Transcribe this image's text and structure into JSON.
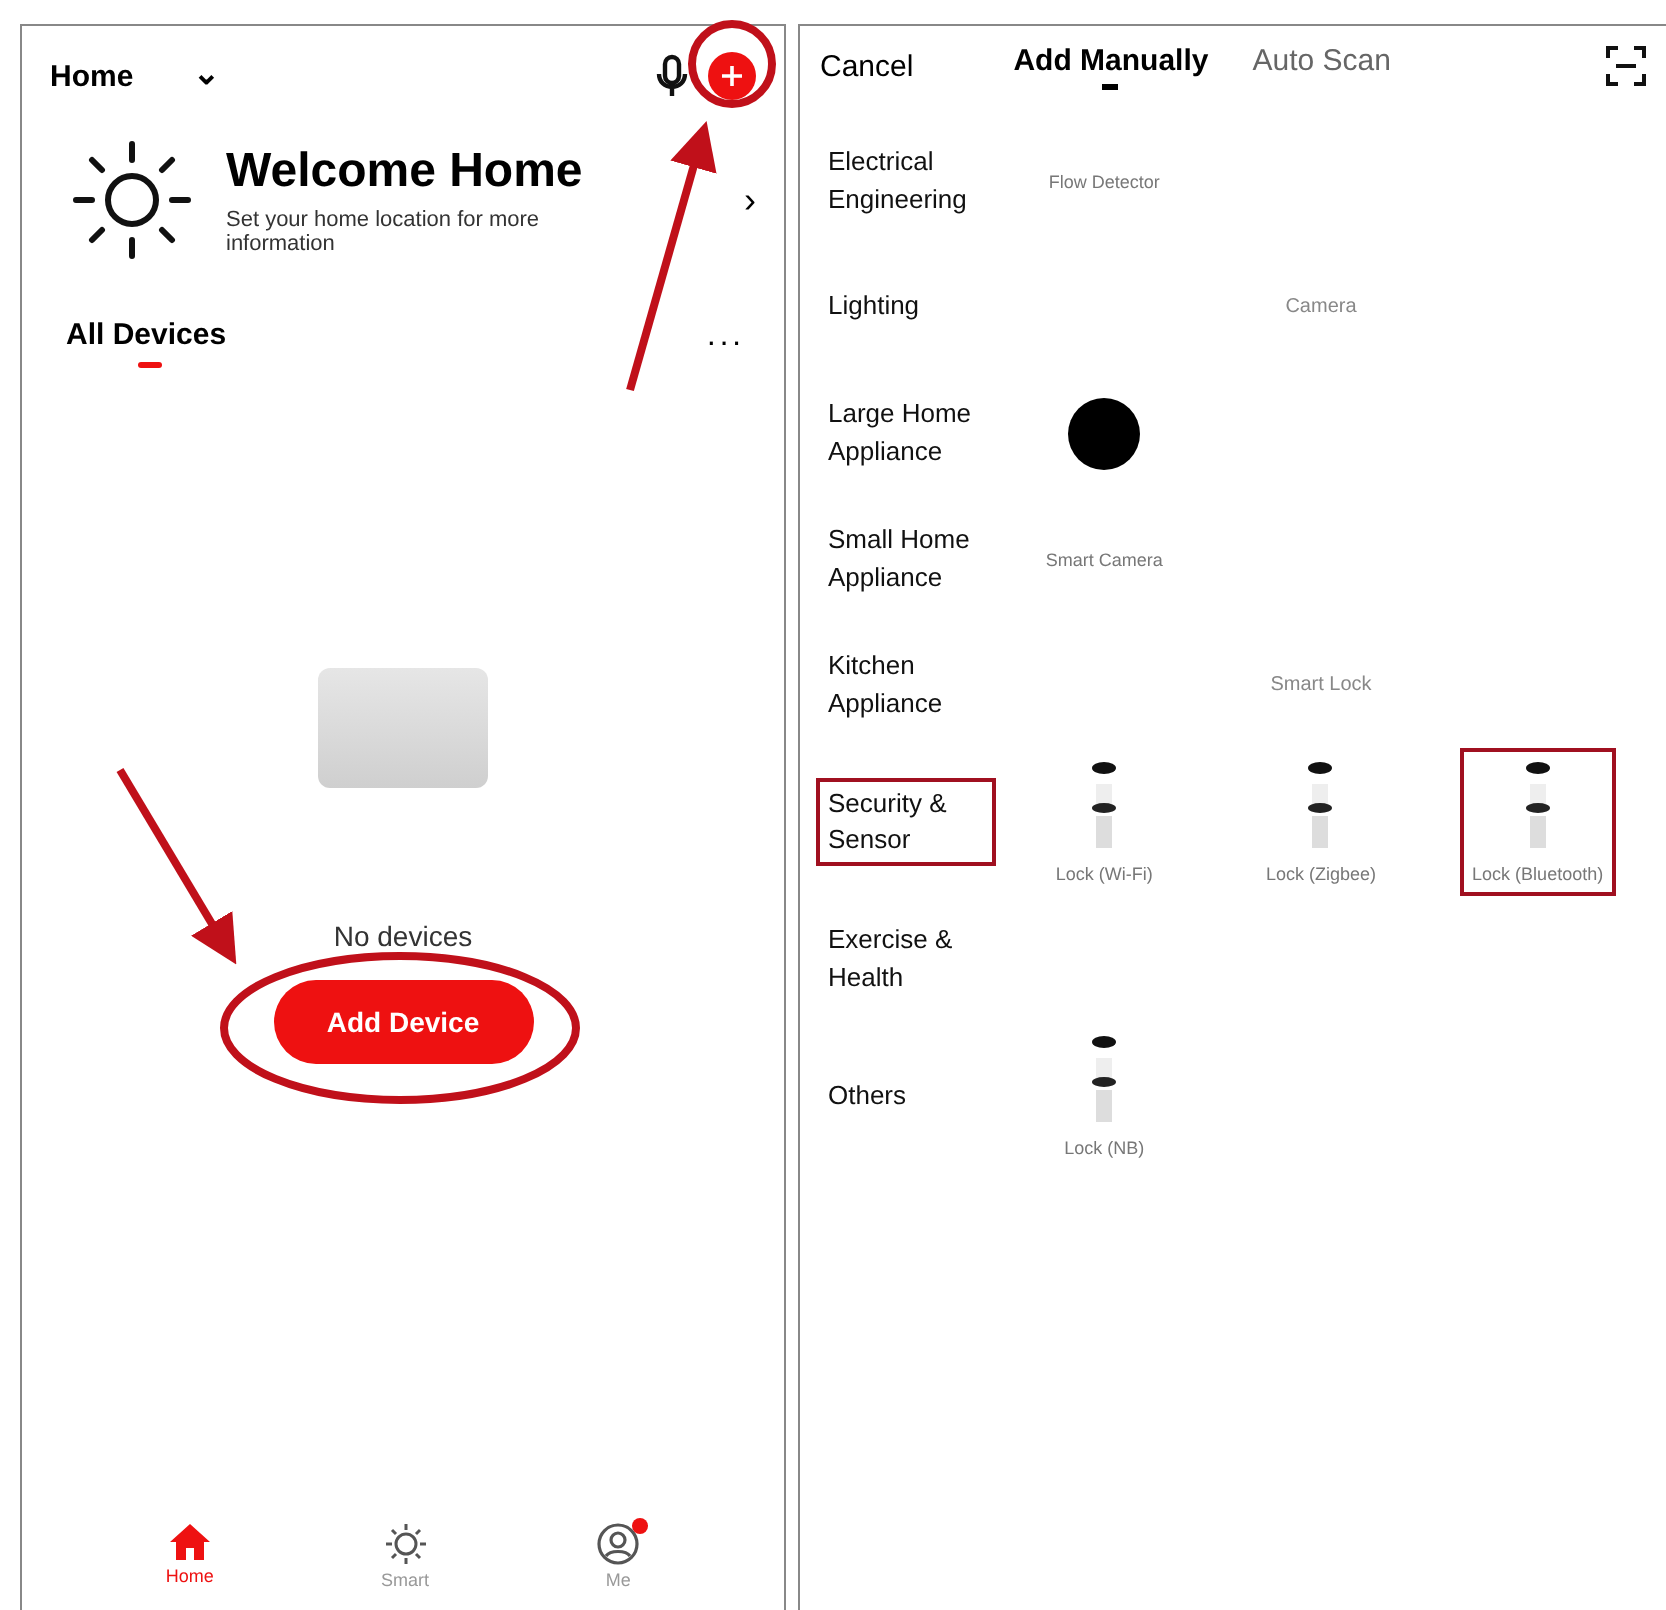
{
  "left_screen": {
    "home_selector": {
      "label": "Home",
      "expand_icon": "⌄"
    },
    "welcome": {
      "title": "Welcome Home",
      "subtitle": "Set your home location for more information",
      "chevron": "›"
    },
    "tabs": [
      {
        "label": "All Devices",
        "selected": true
      }
    ],
    "more": "···",
    "empty_state": {
      "message": "No devices",
      "button": "Add Device"
    },
    "bottom_nav": [
      {
        "label": "Home",
        "kind": "home",
        "selected": true,
        "badge": false
      },
      {
        "label": "Smart",
        "kind": "sun",
        "selected": false,
        "badge": false
      },
      {
        "label": "Me",
        "kind": "user",
        "selected": false,
        "badge": true
      }
    ]
  },
  "right_screen": {
    "cancel": "Cancel",
    "tabs": [
      {
        "label": "Add Manually",
        "selected": true
      },
      {
        "label": "Auto Scan",
        "selected": false
      }
    ],
    "categories": [
      {
        "label": "Electrical Engineering",
        "highlighted": false,
        "items": [
          {
            "kind": "product",
            "label": "Flow Detector",
            "highlighted": false
          }
        ]
      },
      {
        "label": "Lighting",
        "highlighted": false,
        "items": [
          {
            "kind": "heading",
            "label": "Camera"
          }
        ]
      },
      {
        "label": "Large Home Appliance",
        "highlighted": false,
        "items": [
          {
            "kind": "dot"
          }
        ]
      },
      {
        "label": "Small Home Appliance",
        "highlighted": false,
        "items": [
          {
            "kind": "product",
            "label": "Smart Camera",
            "highlighted": false
          }
        ]
      },
      {
        "label": "Kitchen Appliance",
        "highlighted": false,
        "items": [
          {
            "kind": "heading",
            "label": "Smart Lock"
          }
        ]
      },
      {
        "label": "Security & Sensor",
        "highlighted": true,
        "items": [
          {
            "kind": "lock",
            "label": "Lock (Wi-Fi)",
            "highlighted": false
          },
          {
            "kind": "lock",
            "label": "Lock (Zigbee)",
            "highlighted": false
          },
          {
            "kind": "lock",
            "label": "Lock (Bluetooth)",
            "highlighted": true
          }
        ]
      },
      {
        "label": "Exercise & Health",
        "highlighted": false
      },
      {
        "label": "Others",
        "highlighted": false,
        "items": [
          {
            "kind": "lock",
            "label": "Lock (NB)",
            "highlighted": false
          }
        ]
      }
    ]
  }
}
